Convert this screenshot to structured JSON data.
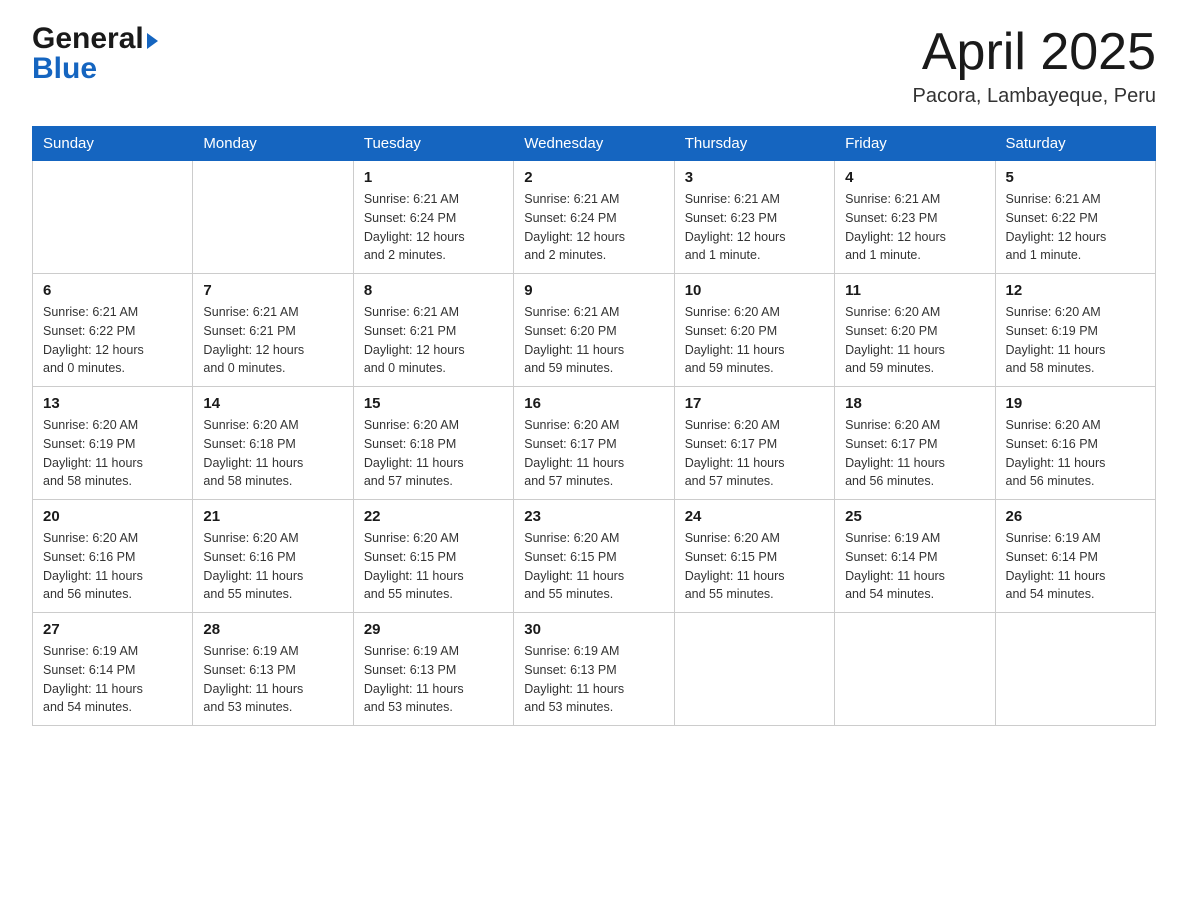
{
  "header": {
    "logo_general": "General",
    "logo_blue": "Blue",
    "month_title": "April 2025",
    "location": "Pacora, Lambayeque, Peru"
  },
  "weekdays": [
    "Sunday",
    "Monday",
    "Tuesday",
    "Wednesday",
    "Thursday",
    "Friday",
    "Saturday"
  ],
  "weeks": [
    [
      {
        "day": "",
        "info": ""
      },
      {
        "day": "",
        "info": ""
      },
      {
        "day": "1",
        "info": "Sunrise: 6:21 AM\nSunset: 6:24 PM\nDaylight: 12 hours\nand 2 minutes."
      },
      {
        "day": "2",
        "info": "Sunrise: 6:21 AM\nSunset: 6:24 PM\nDaylight: 12 hours\nand 2 minutes."
      },
      {
        "day": "3",
        "info": "Sunrise: 6:21 AM\nSunset: 6:23 PM\nDaylight: 12 hours\nand 1 minute."
      },
      {
        "day": "4",
        "info": "Sunrise: 6:21 AM\nSunset: 6:23 PM\nDaylight: 12 hours\nand 1 minute."
      },
      {
        "day": "5",
        "info": "Sunrise: 6:21 AM\nSunset: 6:22 PM\nDaylight: 12 hours\nand 1 minute."
      }
    ],
    [
      {
        "day": "6",
        "info": "Sunrise: 6:21 AM\nSunset: 6:22 PM\nDaylight: 12 hours\nand 0 minutes."
      },
      {
        "day": "7",
        "info": "Sunrise: 6:21 AM\nSunset: 6:21 PM\nDaylight: 12 hours\nand 0 minutes."
      },
      {
        "day": "8",
        "info": "Sunrise: 6:21 AM\nSunset: 6:21 PM\nDaylight: 12 hours\nand 0 minutes."
      },
      {
        "day": "9",
        "info": "Sunrise: 6:21 AM\nSunset: 6:20 PM\nDaylight: 11 hours\nand 59 minutes."
      },
      {
        "day": "10",
        "info": "Sunrise: 6:20 AM\nSunset: 6:20 PM\nDaylight: 11 hours\nand 59 minutes."
      },
      {
        "day": "11",
        "info": "Sunrise: 6:20 AM\nSunset: 6:20 PM\nDaylight: 11 hours\nand 59 minutes."
      },
      {
        "day": "12",
        "info": "Sunrise: 6:20 AM\nSunset: 6:19 PM\nDaylight: 11 hours\nand 58 minutes."
      }
    ],
    [
      {
        "day": "13",
        "info": "Sunrise: 6:20 AM\nSunset: 6:19 PM\nDaylight: 11 hours\nand 58 minutes."
      },
      {
        "day": "14",
        "info": "Sunrise: 6:20 AM\nSunset: 6:18 PM\nDaylight: 11 hours\nand 58 minutes."
      },
      {
        "day": "15",
        "info": "Sunrise: 6:20 AM\nSunset: 6:18 PM\nDaylight: 11 hours\nand 57 minutes."
      },
      {
        "day": "16",
        "info": "Sunrise: 6:20 AM\nSunset: 6:17 PM\nDaylight: 11 hours\nand 57 minutes."
      },
      {
        "day": "17",
        "info": "Sunrise: 6:20 AM\nSunset: 6:17 PM\nDaylight: 11 hours\nand 57 minutes."
      },
      {
        "day": "18",
        "info": "Sunrise: 6:20 AM\nSunset: 6:17 PM\nDaylight: 11 hours\nand 56 minutes."
      },
      {
        "day": "19",
        "info": "Sunrise: 6:20 AM\nSunset: 6:16 PM\nDaylight: 11 hours\nand 56 minutes."
      }
    ],
    [
      {
        "day": "20",
        "info": "Sunrise: 6:20 AM\nSunset: 6:16 PM\nDaylight: 11 hours\nand 56 minutes."
      },
      {
        "day": "21",
        "info": "Sunrise: 6:20 AM\nSunset: 6:16 PM\nDaylight: 11 hours\nand 55 minutes."
      },
      {
        "day": "22",
        "info": "Sunrise: 6:20 AM\nSunset: 6:15 PM\nDaylight: 11 hours\nand 55 minutes."
      },
      {
        "day": "23",
        "info": "Sunrise: 6:20 AM\nSunset: 6:15 PM\nDaylight: 11 hours\nand 55 minutes."
      },
      {
        "day": "24",
        "info": "Sunrise: 6:20 AM\nSunset: 6:15 PM\nDaylight: 11 hours\nand 55 minutes."
      },
      {
        "day": "25",
        "info": "Sunrise: 6:19 AM\nSunset: 6:14 PM\nDaylight: 11 hours\nand 54 minutes."
      },
      {
        "day": "26",
        "info": "Sunrise: 6:19 AM\nSunset: 6:14 PM\nDaylight: 11 hours\nand 54 minutes."
      }
    ],
    [
      {
        "day": "27",
        "info": "Sunrise: 6:19 AM\nSunset: 6:14 PM\nDaylight: 11 hours\nand 54 minutes."
      },
      {
        "day": "28",
        "info": "Sunrise: 6:19 AM\nSunset: 6:13 PM\nDaylight: 11 hours\nand 53 minutes."
      },
      {
        "day": "29",
        "info": "Sunrise: 6:19 AM\nSunset: 6:13 PM\nDaylight: 11 hours\nand 53 minutes."
      },
      {
        "day": "30",
        "info": "Sunrise: 6:19 AM\nSunset: 6:13 PM\nDaylight: 11 hours\nand 53 minutes."
      },
      {
        "day": "",
        "info": ""
      },
      {
        "day": "",
        "info": ""
      },
      {
        "day": "",
        "info": ""
      }
    ]
  ]
}
